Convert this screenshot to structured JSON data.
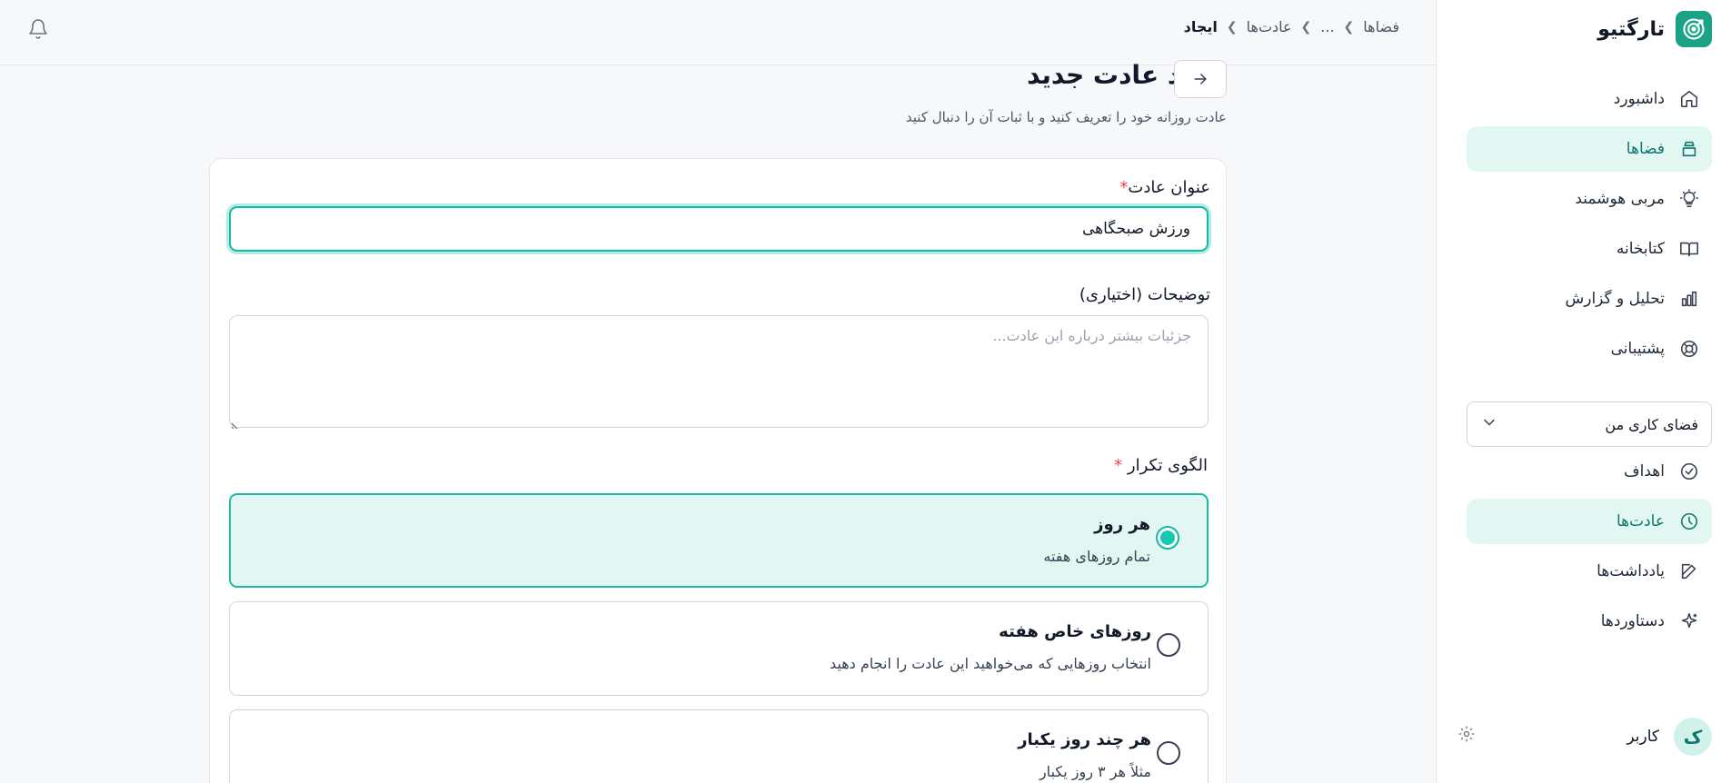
{
  "app": {
    "name": "تارگتیو"
  },
  "sidebar": {
    "items": [
      {
        "label": "داشبورد",
        "icon": "home-icon"
      },
      {
        "label": "فضاها",
        "icon": "layers-icon",
        "active": true
      },
      {
        "label": "مربی هوشمند",
        "icon": "lightbulb-icon"
      },
      {
        "label": "کتابخانه",
        "icon": "book-icon"
      },
      {
        "label": "تحلیل و گزارش",
        "icon": "chart-icon"
      },
      {
        "label": "پشتیبانی",
        "icon": "lifebuoy-icon"
      }
    ],
    "workspace": {
      "label": "فضای کاری من"
    },
    "sub_items": [
      {
        "label": "اهداف",
        "icon": "check-circle-icon"
      },
      {
        "label": "عادت‌ها",
        "icon": "clock-icon",
        "active": true
      },
      {
        "label": "یادداشت‌ها",
        "icon": "edit-icon"
      },
      {
        "label": "دستاوردها",
        "icon": "sparkle-icon"
      }
    ],
    "user": {
      "name": "کاربر",
      "initial": "ک"
    }
  },
  "breadcrumb": [
    "فضاها",
    "...",
    "عادت‌ها",
    "ایجاد"
  ],
  "page": {
    "title": "ایجاد عادت جدید",
    "subtitle": "عادت روزانه خود را تعریف کنید و با ثبات آن را دنبال کنید"
  },
  "form": {
    "title_label": "عنوان عادت",
    "title_required": "*",
    "title_value": "ورزش صبحگاهی",
    "desc_label": "توضیحات (اختیاری)",
    "desc_placeholder": "جزئیات بیشتر درباره این عادت...",
    "pattern_label": "الگوی تکرار",
    "pattern_required": "*",
    "options": [
      {
        "title": "هر روز",
        "desc": "تمام روزهای هفته",
        "selected": true
      },
      {
        "title": "روزهای خاص هفته",
        "desc": "انتخاب روزهایی که می‌خواهید این عادت را انجام دهید",
        "selected": false
      },
      {
        "title": "هر چند روز یکبار",
        "desc": "مثلاً هر ۳ روز یکبار",
        "selected": false
      }
    ]
  },
  "colors": {
    "accent": "#14b8a6",
    "active_bg": "#e3f7f2",
    "brand": "#1aa387"
  }
}
